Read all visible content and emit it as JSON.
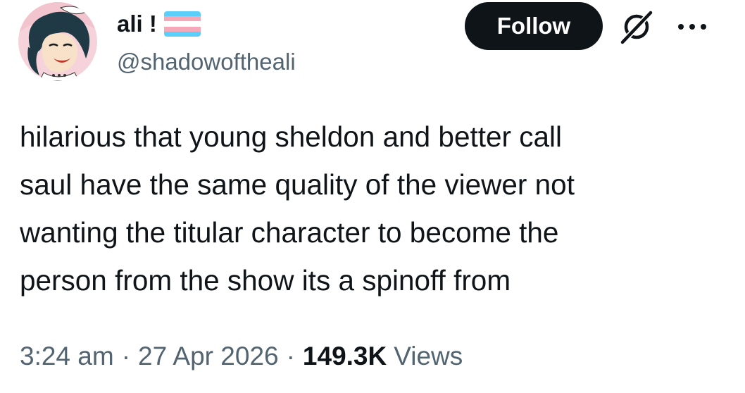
{
  "author": {
    "display_name": "ali !",
    "handle": "@shadowoftheali",
    "avatar_icon": "comic-woman-avatar",
    "flag_icon": "trans-flag-icon",
    "flag_colors": [
      "#5BCEFA",
      "#F5A9B8",
      "#FFFFFF",
      "#F5A9B8",
      "#5BCEFA"
    ]
  },
  "actions": {
    "follow_label": "Follow",
    "grok_icon": "grok-icon",
    "more_icon": "more-options-icon"
  },
  "tweet": {
    "text": "hilarious that young sheldon and better call\nsaul have the same quality of the viewer not\nwanting the titular character to become the\nperson from the show its a spinoff from"
  },
  "meta": {
    "time": "3:24 am",
    "date": "27 Apr 2026",
    "separator": "·",
    "views_count": "149.3K",
    "views_label": "Views"
  },
  "colors": {
    "text_primary": "#0f1419",
    "text_secondary": "#536471",
    "button_bg": "#0f1419",
    "button_text": "#ffffff"
  }
}
